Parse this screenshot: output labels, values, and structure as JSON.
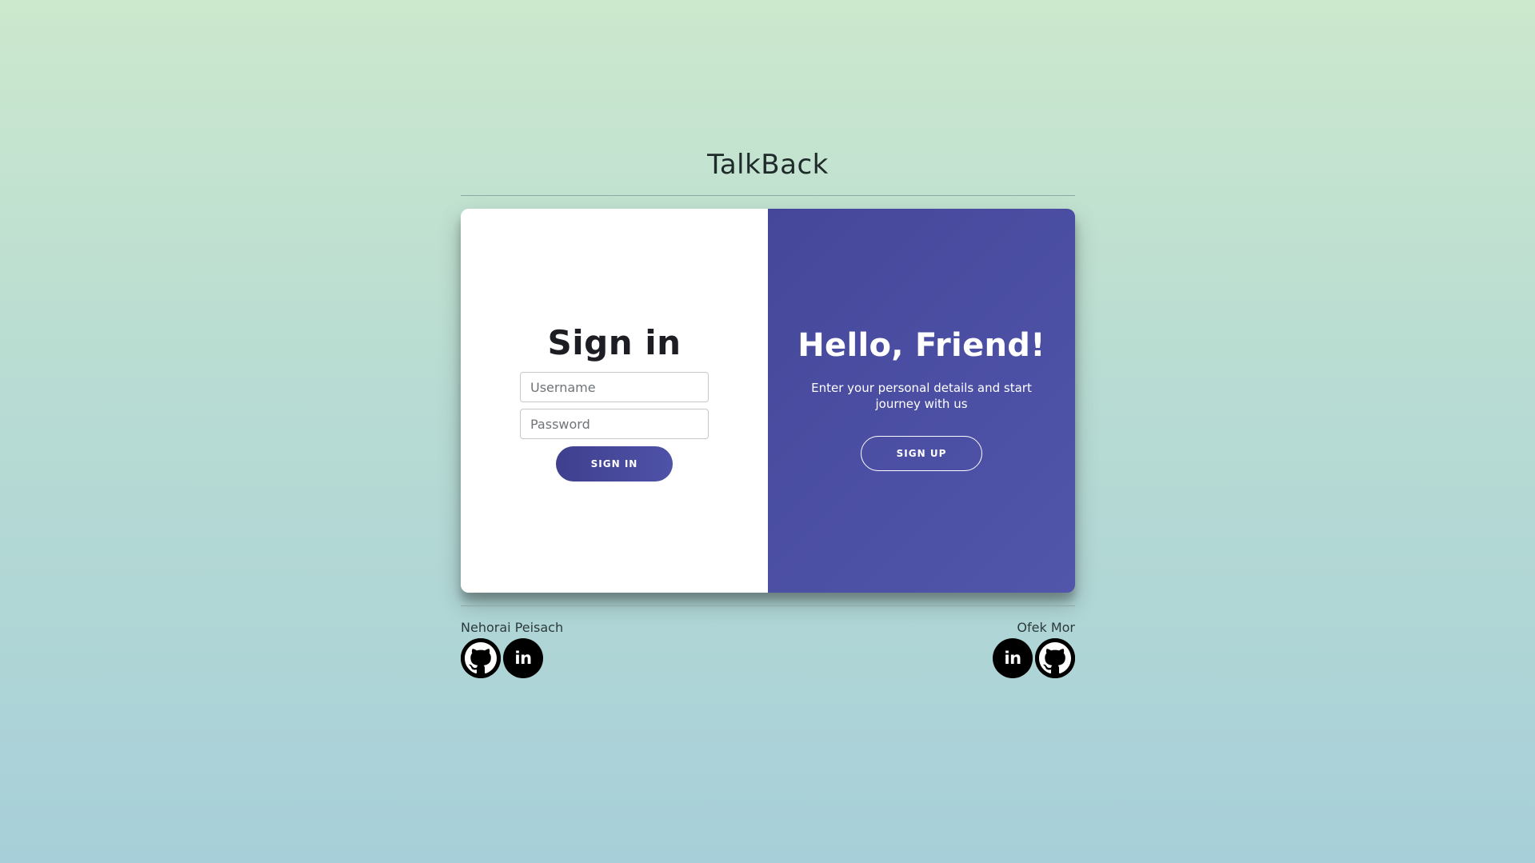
{
  "app": {
    "title": "TalkBack"
  },
  "signin": {
    "heading": "Sign in",
    "username_placeholder": "Username",
    "password_placeholder": "Password",
    "button_label": "SIGN IN"
  },
  "welcome": {
    "heading": "Hello, Friend!",
    "message": "Enter your personal details and start journey with us",
    "button_label": "SIGN UP"
  },
  "footer": {
    "authors": [
      {
        "name": "Nehorai Peisach",
        "icons": [
          "github-icon",
          "linkedin-icon"
        ],
        "linkedin_text": "in"
      },
      {
        "name": "Ofek Mor",
        "icons": [
          "linkedin-icon",
          "github-icon"
        ],
        "linkedin_text": "in"
      }
    ]
  },
  "colors": {
    "accent": "#4e52a8",
    "accent_dark": "#3f3f8e",
    "background_top": "#cce8cd",
    "background_bottom": "#a7cfd9"
  }
}
